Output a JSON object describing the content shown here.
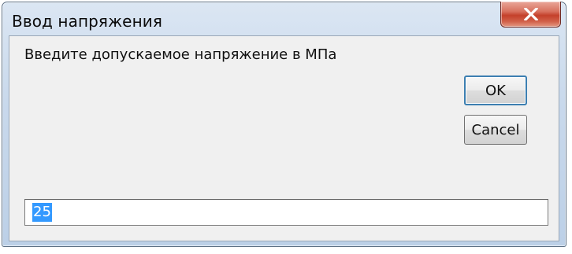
{
  "window": {
    "title": "Ввод напряжения",
    "close_icon": "close-icon"
  },
  "dialog": {
    "prompt": "Введите допускаемое напряжение в МПа",
    "ok_label": "OK",
    "cancel_label": "Cancel",
    "input_value": "25",
    "input_value_selected": true
  },
  "colors": {
    "close_button": "#c4402a",
    "selection": "#3399ff",
    "default_button_border": "#3c7fb1"
  }
}
